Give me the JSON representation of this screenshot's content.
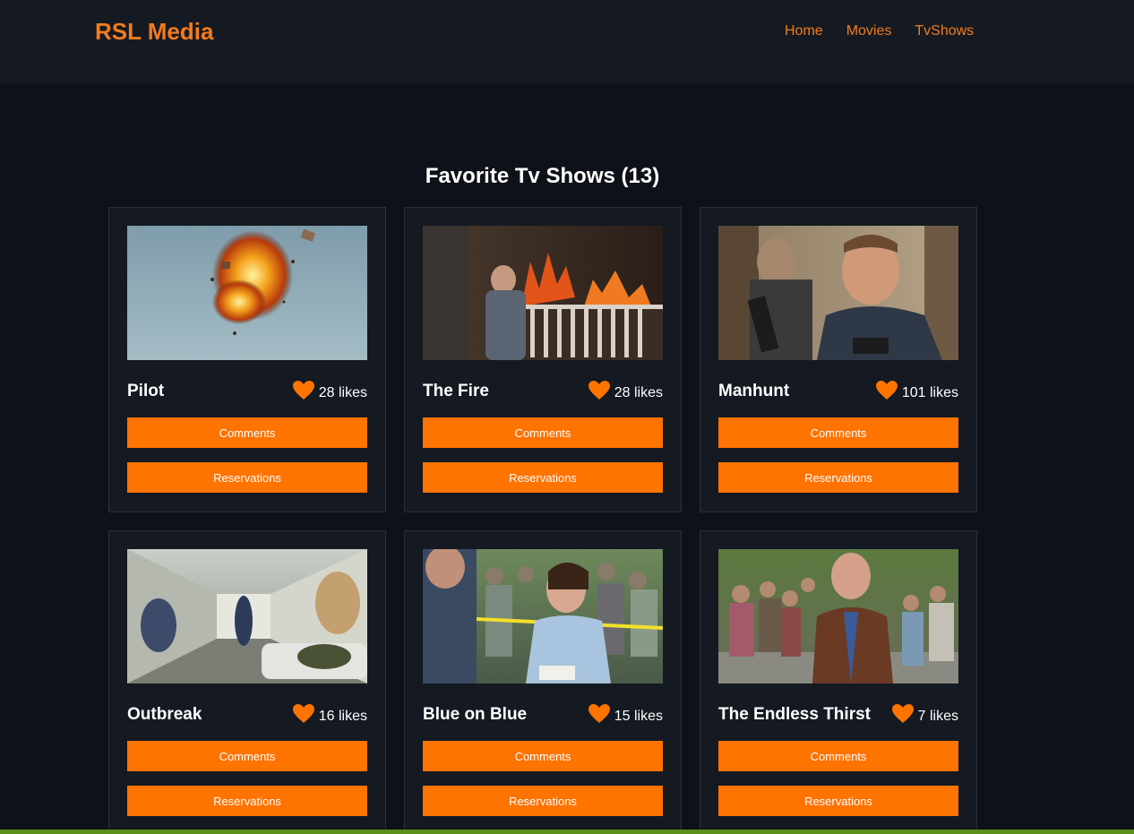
{
  "brand": "RSL Media",
  "nav": [
    {
      "label": "Home"
    },
    {
      "label": "Movies"
    },
    {
      "label": "TvShows"
    }
  ],
  "heading": "Favorite Tv Shows (13)",
  "colors": {
    "accent": "#ff7300",
    "brand": "#f27b1e",
    "background": "#0e1119",
    "card": "#141922"
  },
  "shows": [
    {
      "title": "Pilot",
      "likes": "28 likes",
      "comments_label": "Comments",
      "reservations_label": "Reservations"
    },
    {
      "title": "The Fire",
      "likes": "28 likes",
      "comments_label": "Comments",
      "reservations_label": "Reservations"
    },
    {
      "title": "Manhunt",
      "likes": "101 likes",
      "comments_label": "Comments",
      "reservations_label": "Reservations"
    },
    {
      "title": "Outbreak",
      "likes": "16 likes",
      "comments_label": "Comments",
      "reservations_label": "Reservations"
    },
    {
      "title": "Blue on Blue",
      "likes": "15 likes",
      "comments_label": "Comments",
      "reservations_label": "Reservations"
    },
    {
      "title": "The Endless Thirst",
      "likes": "7 likes",
      "comments_label": "Comments",
      "reservations_label": "Reservations"
    }
  ]
}
